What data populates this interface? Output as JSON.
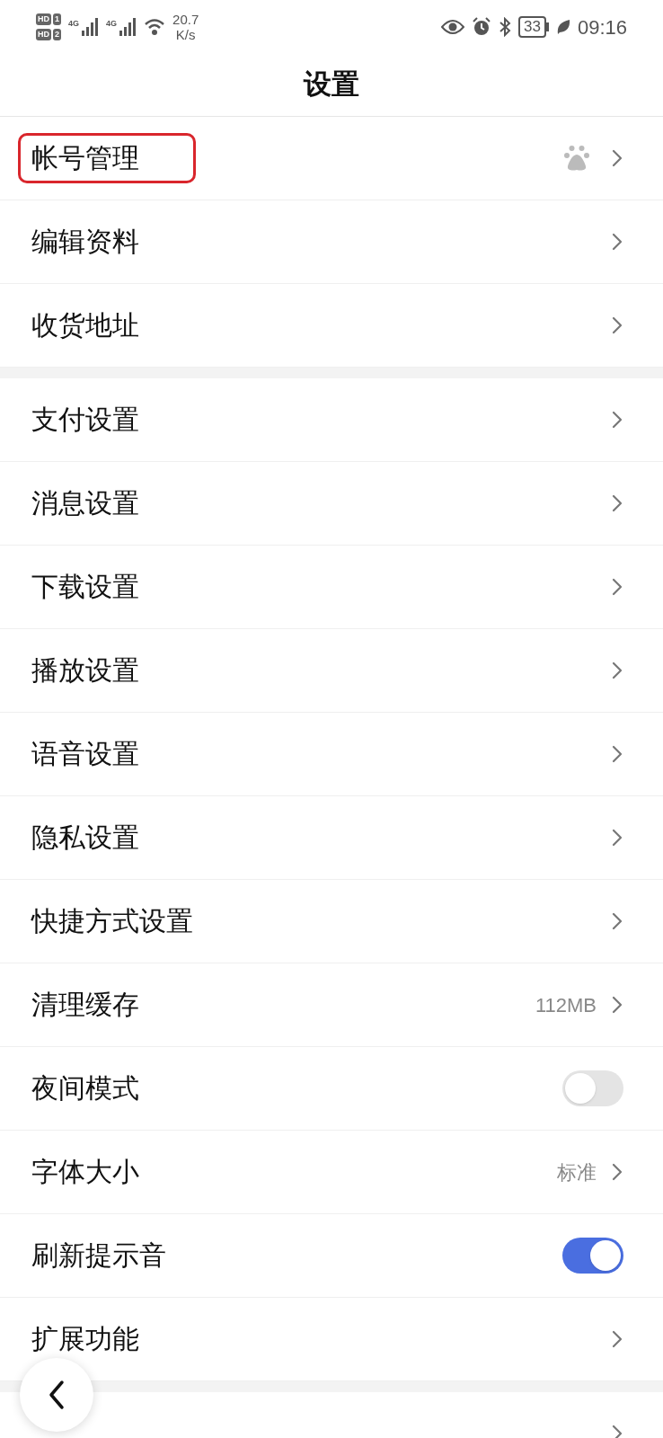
{
  "status_bar": {
    "sims": [
      {
        "badge": "HD",
        "slot": "1"
      },
      {
        "badge": "HD",
        "slot": "2"
      }
    ],
    "networks": [
      "4G",
      "4G"
    ],
    "speed": "20.7",
    "speed_unit": "K/s",
    "battery": "33",
    "time": "09:16"
  },
  "title": "设置",
  "groups": [
    {
      "items": [
        {
          "kind": "icon",
          "label": "帐号管理",
          "highlighted": true
        },
        {
          "kind": "link",
          "label": "编辑资料",
          "highlighted": false
        },
        {
          "kind": "link",
          "label": "收货地址",
          "highlighted": false
        }
      ]
    },
    {
      "items": [
        {
          "kind": "link",
          "label": "支付设置",
          "highlighted": false
        },
        {
          "kind": "link",
          "label": "消息设置",
          "highlighted": false
        },
        {
          "kind": "link",
          "label": "下载设置",
          "highlighted": false
        },
        {
          "kind": "link",
          "label": "播放设置",
          "highlighted": false
        },
        {
          "kind": "link",
          "label": "语音设置",
          "highlighted": false
        },
        {
          "kind": "link",
          "label": "隐私设置",
          "highlighted": false
        },
        {
          "kind": "link",
          "label": "快捷方式设置",
          "highlighted": false
        },
        {
          "kind": "value",
          "label": "清理缓存",
          "value": "112MB",
          "highlighted": false
        },
        {
          "kind": "toggle",
          "label": "夜间模式",
          "on": false,
          "highlighted": false
        },
        {
          "kind": "value",
          "label": "字体大小",
          "value": "标准",
          "highlighted": false
        },
        {
          "kind": "toggle",
          "label": "刷新提示音",
          "on": true,
          "highlighted": false
        },
        {
          "kind": "link",
          "label": "扩展功能",
          "highlighted": false
        }
      ]
    },
    {
      "items": [
        {
          "kind": "link"
        }
      ]
    }
  ]
}
